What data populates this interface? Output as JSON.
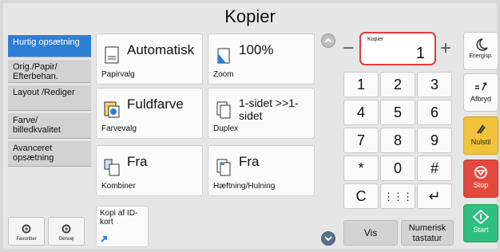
{
  "app": {
    "title": "Kopier"
  },
  "sidebar": {
    "items": [
      {
        "label": "Hurtig opsætning",
        "active": true
      },
      {
        "label": "Orig./Papir/ Efterbehan.",
        "active": false
      },
      {
        "label": "Layout /Rediger",
        "active": false
      },
      {
        "label": "Farve/ billedkvalitet",
        "active": false
      },
      {
        "label": "Avanceret opsætning",
        "active": false
      }
    ],
    "favorites_label": "Favoritter",
    "shortcut_label": "Genvej"
  },
  "tiles": {
    "paper": {
      "value": "Automatisk",
      "label": "Papirvalg"
    },
    "zoom": {
      "value": "100%",
      "label": "Zoom"
    },
    "color": {
      "value": "Fuldfarve",
      "label": "Farvevalg"
    },
    "duplex": {
      "value": "1-sidet >>1-sidet",
      "label": "Duplex"
    },
    "combine": {
      "value": "Fra",
      "label": "Kombiner"
    },
    "staple": {
      "value": "Fra",
      "label": "Hæftning/Hulning"
    },
    "id_card": {
      "label": "Kopi af ID-kort"
    }
  },
  "copies": {
    "caption": "Kopier",
    "value": "1",
    "minus": "−",
    "plus": "+"
  },
  "keypad": {
    "keys": [
      "1",
      "2",
      "3",
      "4",
      "5",
      "6",
      "7",
      "8",
      "9",
      "*",
      "0",
      "#"
    ],
    "clear": "C",
    "grid": "⋮⋮⋮",
    "enter": "↵"
  },
  "bottom": {
    "vis": "Vis",
    "numeric": "Numerisk tastatur"
  },
  "right_buttons": {
    "energy": "Energisp.",
    "reset": "Afbryd",
    "nulstil": "Nulstil",
    "stop": "Stop",
    "start": "Start"
  },
  "colors": {
    "accent": "#2d7fd6",
    "highlight": "#e23b3b",
    "nulstil": "#f2c23a",
    "stop": "#e34a3f",
    "start": "#2fbf7f"
  }
}
